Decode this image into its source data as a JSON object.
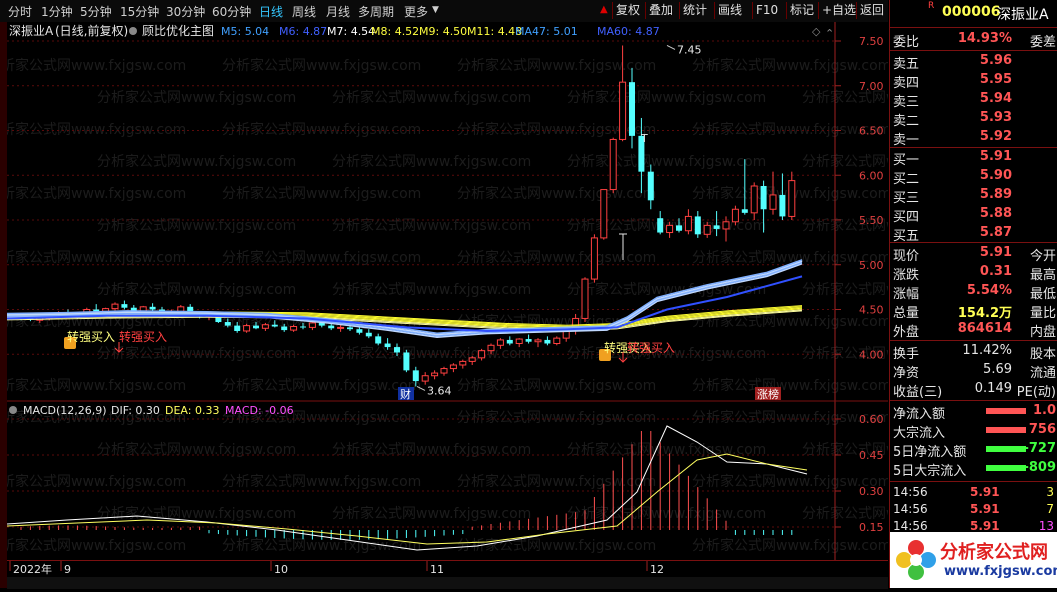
{
  "toolbar": {
    "periods": [
      "分时",
      "1分钟",
      "5分钟",
      "15分钟",
      "30分钟",
      "60分钟",
      "日线",
      "周线",
      "月线",
      "多周期",
      "更多"
    ],
    "active_period": "日线",
    "buttons": [
      "复权",
      "叠加",
      "统计",
      "画线",
      "F10",
      "标记",
      "+自选",
      "返回"
    ]
  },
  "main_legend": {
    "stock": "深振业A",
    "mode": "(日线,前复权)",
    "indicator": "顾比优化主图",
    "ma": [
      {
        "label": "M5: 5.04",
        "color": "#40a0ff"
      },
      {
        "label": "M6: 4.87",
        "color": "#4060ff"
      },
      {
        "label": "M7: 4.54",
        "color": "#ffffff"
      },
      {
        "label": "M8: 4.52",
        "color": "#ffff40"
      },
      {
        "label": "M9: 4.50",
        "color": "#ffff40"
      },
      {
        "label": "M11: 4.48",
        "color": "#ffff40"
      },
      {
        "label": "MA47: 5.01",
        "color": "#40a0ff"
      },
      {
        "label": "MA60: 4.87",
        "color": "#4060ff"
      }
    ]
  },
  "annotations": {
    "high": "7.45",
    "low": "3.64",
    "signal1": "转强买入",
    "signal2": "转强买入",
    "signal3": "转强买入",
    "signal4": "转强买入",
    "badge_cai": "财",
    "badge_zhang": "涨榜",
    "t_marker": "T"
  },
  "main_axis": [
    "7.50",
    "7.00",
    "6.50",
    "6.00",
    "5.50",
    "5.00",
    "4.50",
    "4.00"
  ],
  "macd_legend": {
    "name": "MACD(12,26,9)",
    "dif": "DIF: 0.30",
    "dea": "DEA: 0.33",
    "macd": "MACD: -0.06"
  },
  "macd_axis": [
    "0.60",
    "0.45",
    "0.30",
    "0.15"
  ],
  "date_axis": [
    "2022年",
    "9",
    "10",
    "11",
    "12"
  ],
  "panel": {
    "code": "000006",
    "name": "深振业A",
    "weibi_label": "委比",
    "weibi": "14.93%",
    "weicha_label": "委差",
    "sell": [
      {
        "label": "卖五",
        "price": "5.96"
      },
      {
        "label": "卖四",
        "price": "5.95"
      },
      {
        "label": "卖三",
        "price": "5.94"
      },
      {
        "label": "卖二",
        "price": "5.93"
      },
      {
        "label": "卖一",
        "price": "5.92"
      }
    ],
    "buy": [
      {
        "label": "买一",
        "price": "5.91"
      },
      {
        "label": "买二",
        "price": "5.90"
      },
      {
        "label": "买三",
        "price": "5.89"
      },
      {
        "label": "买四",
        "price": "5.88"
      },
      {
        "label": "买五",
        "price": "5.87"
      }
    ],
    "quote": [
      {
        "label": "现价",
        "value": "5.91",
        "label2": "今开",
        "color": "#ff5555"
      },
      {
        "label": "涨跌",
        "value": "0.31",
        "label2": "最高",
        "color": "#ff5555"
      },
      {
        "label": "涨幅",
        "value": "5.54%",
        "label2": "最低",
        "color": "#ff5555"
      },
      {
        "label": "总量",
        "value": "154.2万",
        "label2": "量比",
        "color": "#ffff55"
      },
      {
        "label": "外盘",
        "value": "864614",
        "label2": "内盘",
        "color": "#ff5555"
      }
    ],
    "stats": [
      {
        "label": "换手",
        "value": "11.42%",
        "label2": "股本",
        "color": "#e6e6e6"
      },
      {
        "label": "净资",
        "value": "5.69",
        "label2": "流通",
        "color": "#e6e6e6"
      },
      {
        "label": "收益(三)",
        "value": "0.149",
        "label2": "PE(动)",
        "color": "#e6e6e6"
      }
    ],
    "flows": [
      {
        "label": "净流入额",
        "value": "1.0",
        "color": "#ff5555"
      },
      {
        "label": "大宗流入",
        "value": "756",
        "color": "#ff5555"
      },
      {
        "label": "5日净流入额",
        "value": "-727",
        "color": "#40ff40"
      },
      {
        "label": "5日大宗流入",
        "value": "-809",
        "color": "#40ff40"
      }
    ],
    "ticks": [
      {
        "time": "14:56",
        "price": "5.91",
        "vol": "3"
      },
      {
        "time": "14:56",
        "price": "5.91",
        "vol": "7"
      },
      {
        "time": "14:56",
        "price": "5.91",
        "vol": "13"
      }
    ]
  },
  "watermark": {
    "text": "分析家公式网",
    "url": "www.fxjgsw.com"
  },
  "logo": {
    "text": "分析家公式网",
    "url": "www.fxjgsw.com"
  }
}
